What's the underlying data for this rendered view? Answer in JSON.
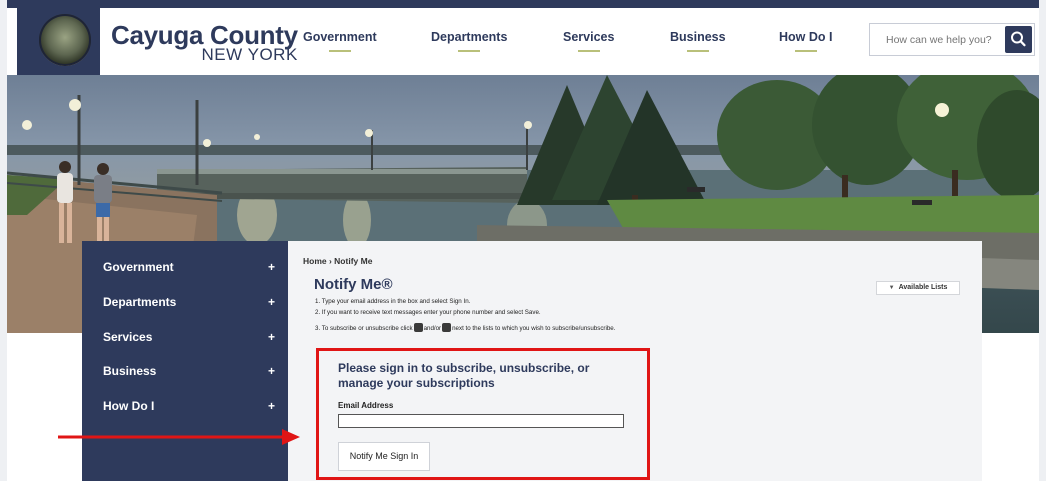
{
  "header": {
    "brand_name": "Cayuga County",
    "brand_sub": "NEW YORK",
    "nav": [
      "Government",
      "Departments",
      "Services",
      "Business",
      "How Do I"
    ],
    "search_placeholder": "How can we help you?"
  },
  "sidebar": {
    "items": [
      "Government",
      "Departments",
      "Services",
      "Business",
      "How Do I"
    ],
    "expand_symbol": "+"
  },
  "main": {
    "breadcrumb": "Home › Notify Me",
    "title": "Notify Me®",
    "instructions": [
      "1. Type your email address in the box and select Sign In.",
      "2. If you want to receive text messages enter your phone number and select Save.",
      "3. To subscribe or unsubscribe click",
      "and/or",
      "next to the lists to which you wish to subscribe/unsubscribe."
    ],
    "available_lists": "Available Lists",
    "signin": {
      "heading": "Please sign in to subscribe, unsubscribe, or manage your subscriptions",
      "email_label": "Email Address",
      "email_value": "",
      "button": "Notify Me Sign In"
    }
  },
  "colors": {
    "brand_navy": "#2e3a5c",
    "highlight_red": "#e01515",
    "nav_underline": "#b9c07a"
  },
  "icons": [
    "search-icon",
    "county-seal-logo",
    "email-notify-icon",
    "sms-notify-icon",
    "dropdown-triangle-icon"
  ]
}
